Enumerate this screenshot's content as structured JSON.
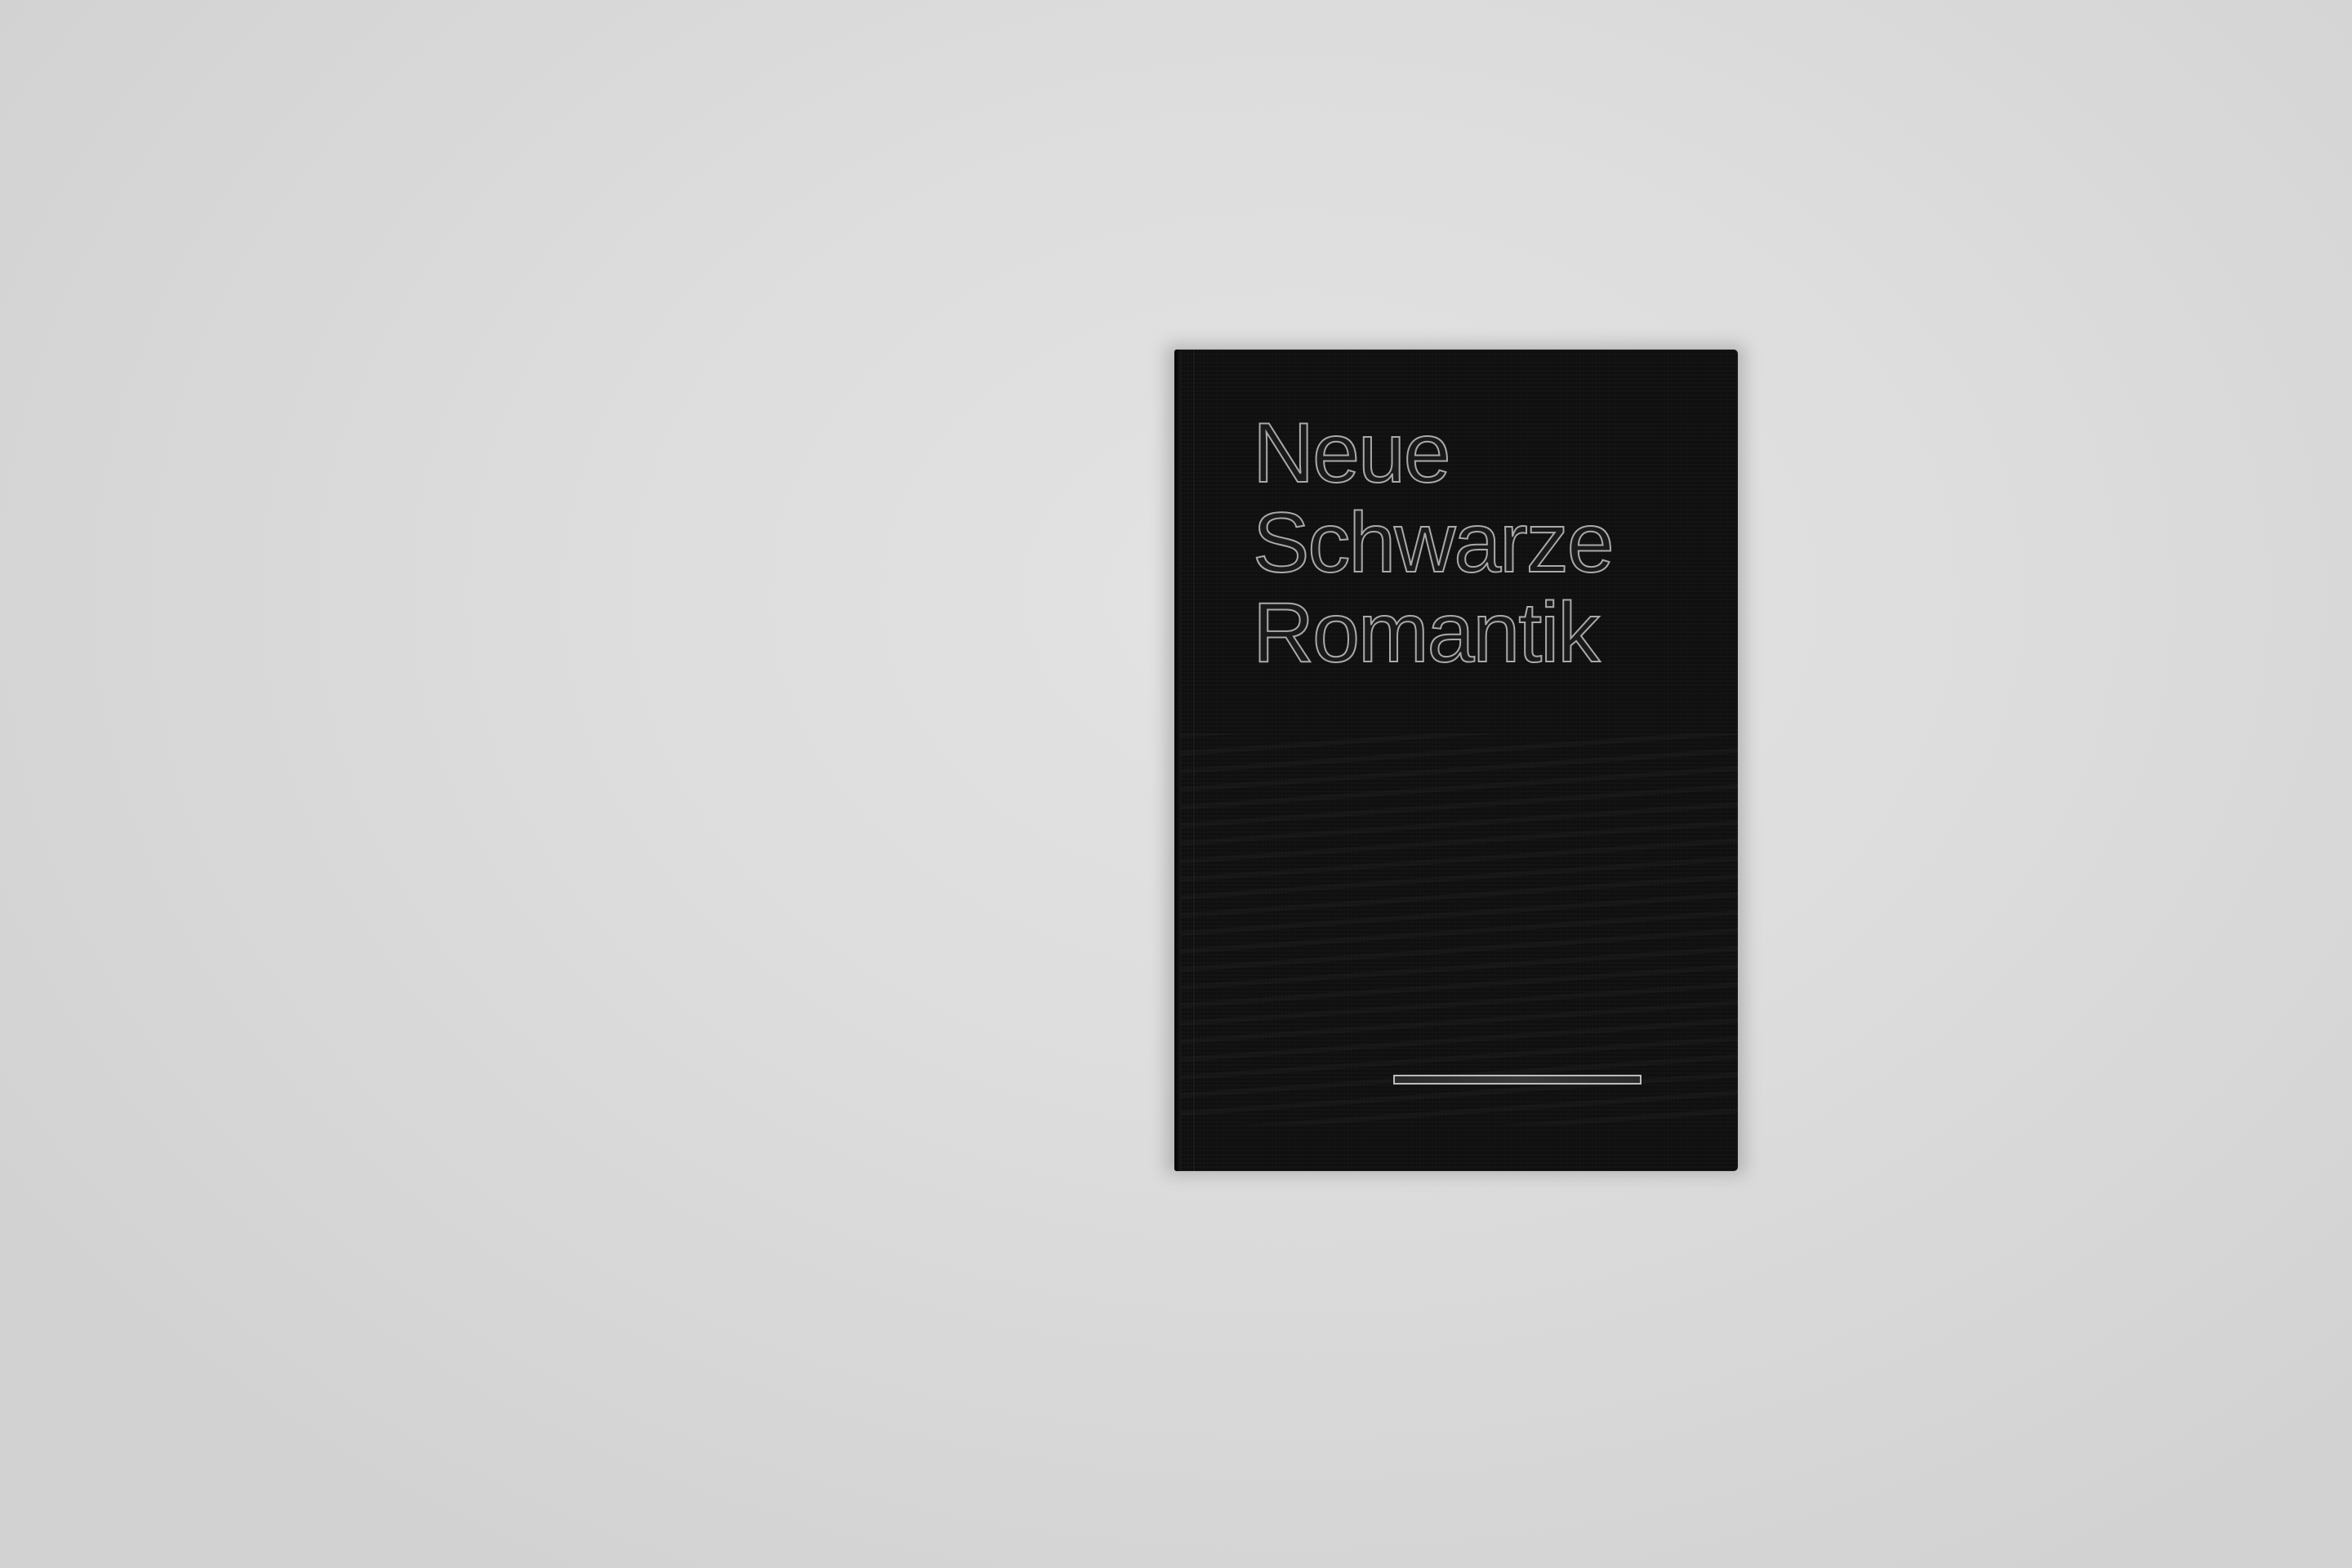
{
  "scene": {
    "background_color": "#dcdcdc",
    "book_color": "#0f0f0f",
    "foil_color": "#a9a9a9"
  },
  "book": {
    "title_lines": [
      "Neue",
      "Schwarze",
      "Romantik"
    ]
  }
}
